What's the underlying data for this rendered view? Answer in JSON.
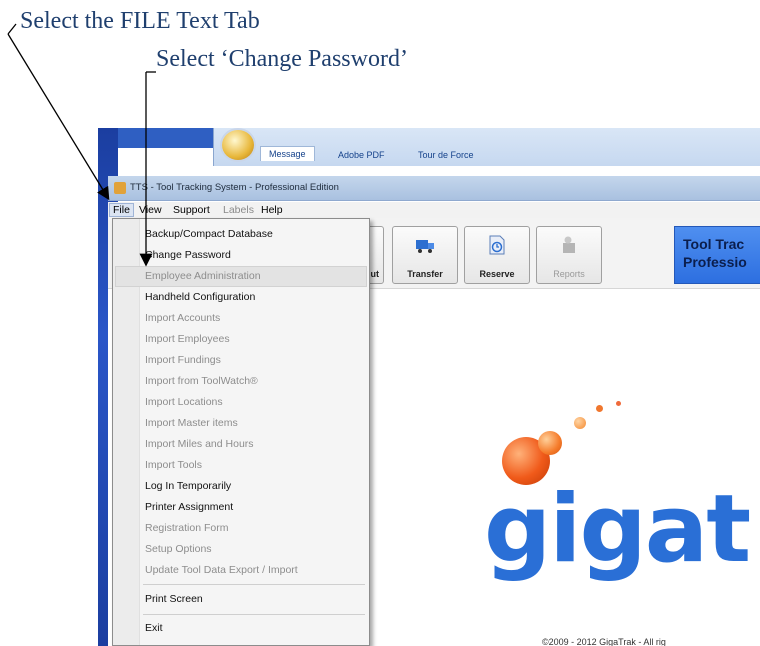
{
  "annotations": {
    "step1": "Select the FILE Text Tab",
    "step2": "Select ‘Change Password’"
  },
  "outlook": {
    "tabs": [
      "Message",
      "Adobe PDF",
      "Tour de Force"
    ]
  },
  "app": {
    "title": "TTS - Tool Tracking System - Professional Edition",
    "menubar": {
      "file": "File",
      "view": "View",
      "support": "Support",
      "labels": "Labels",
      "help": "Help"
    },
    "toolbar": {
      "partial_label": "ut",
      "transfer": "Transfer",
      "reserve": "Reserve",
      "reports": "Reports",
      "brand_line1": "Tool Trac",
      "brand_line2": "Professio"
    },
    "logo_text": "gigat",
    "copyright": "©2009 - 2012 GigaTrak - All rig"
  },
  "file_menu": {
    "items": [
      {
        "label": "Backup/Compact Database",
        "enabled": true
      },
      {
        "label": "Change Password",
        "enabled": true
      },
      {
        "label": "Employee Administration",
        "enabled": false
      },
      {
        "label": "Handheld Configuration",
        "enabled": true
      },
      {
        "label": "Import Accounts",
        "enabled": false
      },
      {
        "label": "Import Employees",
        "enabled": false
      },
      {
        "label": "Import Fundings",
        "enabled": false
      },
      {
        "label": "Import from ToolWatch®",
        "enabled": false
      },
      {
        "label": "Import Locations",
        "enabled": false
      },
      {
        "label": "Import Master items",
        "enabled": false
      },
      {
        "label": "Import Miles and Hours",
        "enabled": false
      },
      {
        "label": "Import Tools",
        "enabled": false
      },
      {
        "label": "Log In Temporarily",
        "enabled": true
      },
      {
        "label": "Printer Assignment",
        "enabled": true
      },
      {
        "label": "Registration Form",
        "enabled": false
      },
      {
        "label": "Setup Options",
        "enabled": false
      },
      {
        "label": "Update Tool Data Export / Import",
        "enabled": false
      },
      {
        "label": "Print Screen",
        "enabled": true
      },
      {
        "label": "Exit",
        "enabled": true
      }
    ]
  },
  "colors": {
    "annotation_text": "#1f3f6e",
    "brand_blue": "#2a6fd6",
    "logo_orange": "#f05a1a"
  }
}
